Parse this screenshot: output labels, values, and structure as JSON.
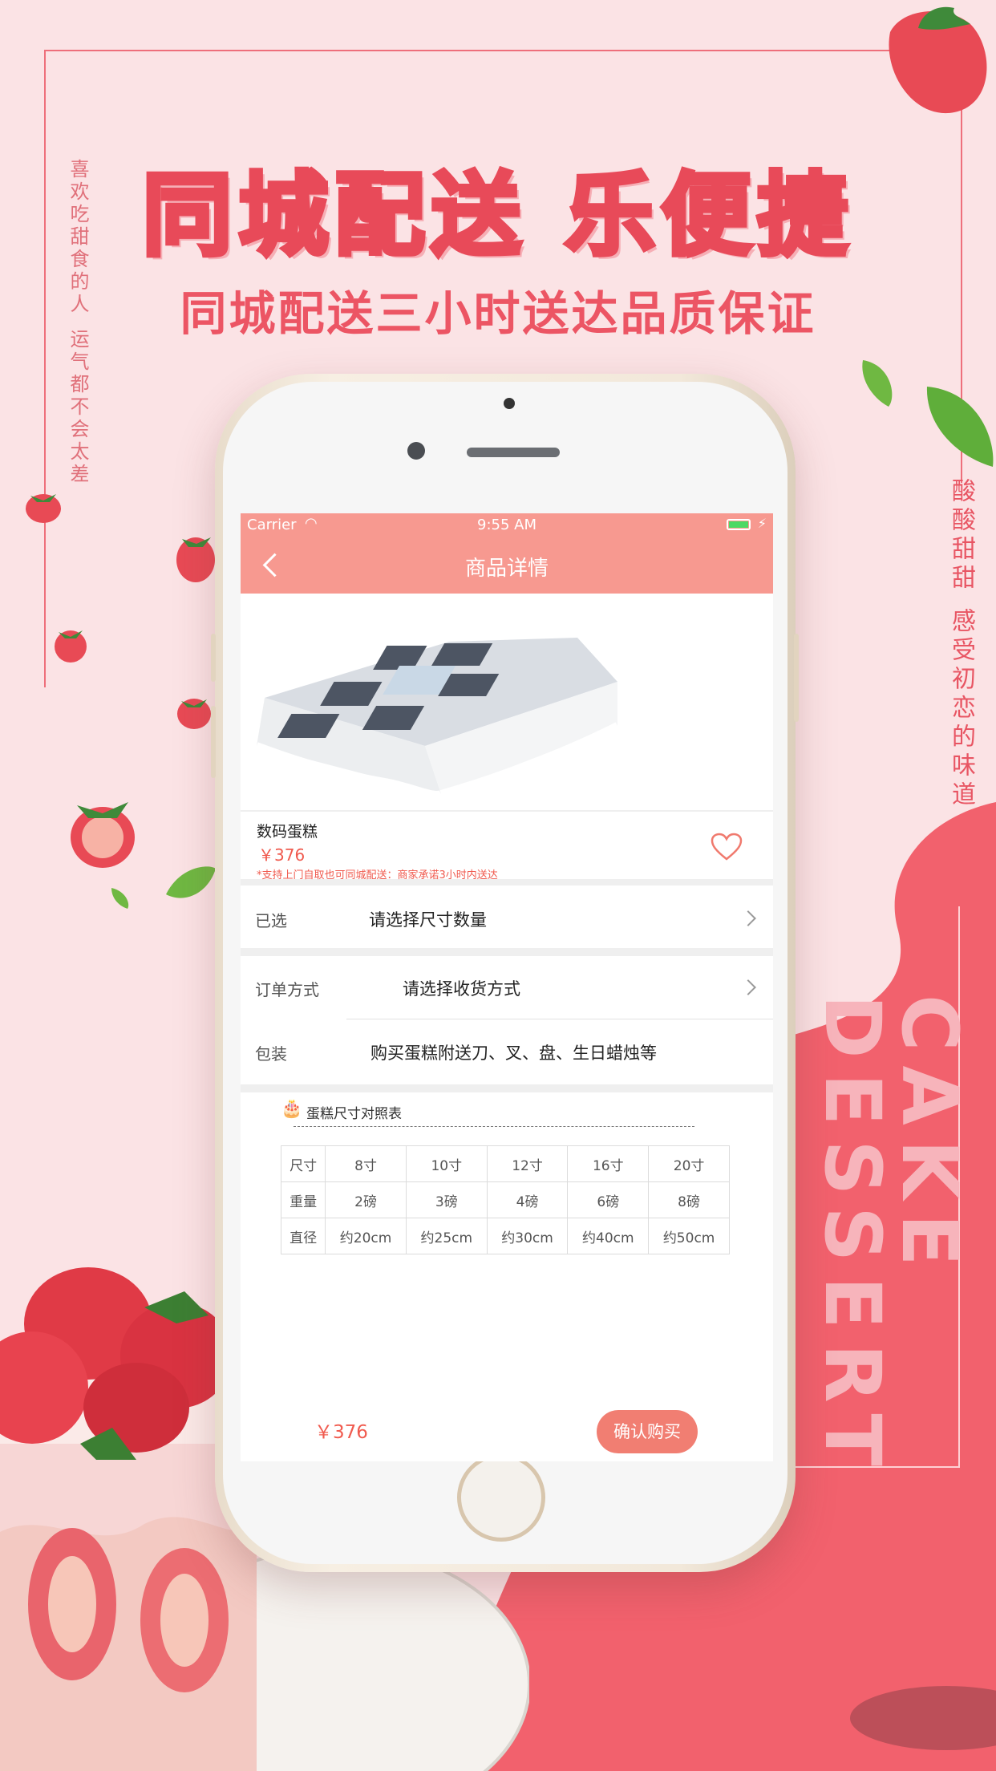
{
  "poster": {
    "title": "同城配送 乐便捷",
    "subtitle": "同城配送三小时送达品质保证",
    "left_vertical_1": "喜欢吃甜食的人",
    "left_vertical_2": "运气都不会太差",
    "right_vertical_1": "酸酸甜甜",
    "right_vertical_2": "感受初恋的味道",
    "brand_vertical": "CAKE DESSERT"
  },
  "status_bar": {
    "carrier": "Carrier",
    "time": "9:55 AM"
  },
  "nav": {
    "title": "商品详情"
  },
  "product": {
    "name": "数码蛋糕",
    "price": "￥376",
    "note": "*支持上门自取也可同城配送：商家承诺3小时内送达"
  },
  "options": {
    "selected_label": "已选",
    "selected_value": "请选择尺寸数量",
    "order_label": "订单方式",
    "order_value": "请选择收货方式",
    "package_label": "包装",
    "package_value": "购买蛋糕附送刀、叉、盘、生日蜡烛等"
  },
  "size_table": {
    "title": "蛋糕尺寸对照表",
    "rows": [
      [
        "尺寸",
        "8寸",
        "10寸",
        "12寸",
        "16寸",
        "20寸"
      ],
      [
        "重量",
        "2磅",
        "3磅",
        "4磅",
        "6磅",
        "8磅"
      ],
      [
        "直径",
        "约20cm",
        "约25cm",
        "约30cm",
        "约40cm",
        "约50cm"
      ]
    ]
  },
  "footer": {
    "price": "￥376",
    "buy_label": "确认购买"
  },
  "colors": {
    "accent": "#f79990",
    "poster_red": "#ec5564",
    "price_red": "#f05a4e"
  }
}
